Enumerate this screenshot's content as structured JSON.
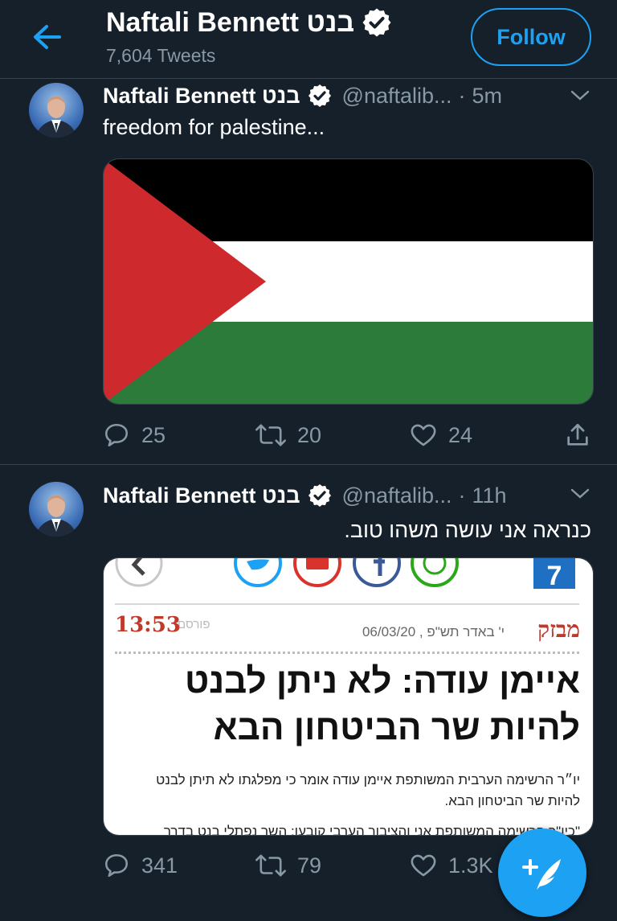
{
  "header": {
    "title": "Naftali Bennett בנט",
    "tweet_count": "7,604 Tweets",
    "follow_label": "Follow"
  },
  "tweets": [
    {
      "name": "Naftali Bennett בנט",
      "handle": "@naftalib...",
      "dot": "·",
      "time": "5m",
      "text": "freedom for palestine...",
      "replies": "25",
      "retweets": "20",
      "likes": "24"
    },
    {
      "name": "Naftali Bennett בנט",
      "handle": "@naftalib...",
      "dot": "·",
      "time": "11h",
      "text": "כנראה אני עושה משהו טוב.",
      "replies": "341",
      "retweets": "79",
      "likes": "1.3K",
      "article": {
        "badge_number": "7",
        "breaking": "מבזק",
        "date": "י' באדר תש\"פ , 06/03/20",
        "published_label": "פורסם",
        "time": "13:53",
        "headline_1": "איימן עודה: לא ניתן לבנט",
        "headline_2": "להיות שר הביטחון הבא",
        "body_1": "יו״ר הרשימה הערבית המשותפת איימן עודה אומר כי מפלגתו לא תיתן לבנט",
        "body_2": "להיות שר הביטחון הבא.",
        "body_3": "\"כיו\"ר הרשימה המשותפת אני והציבור הערבי קובעו: השר נפתלי בנט בדרך"
      }
    }
  ],
  "colors": {
    "background": "#15202b",
    "accent": "#1da1f2",
    "secondary_text": "#8899a6",
    "divider": "#38444d",
    "flag_red": "#ce2a2e",
    "flag_green": "#2c7b3a",
    "flag_black": "#000000",
    "flag_white": "#ffffff"
  },
  "icons": [
    "back-arrow-icon",
    "verified-badge-icon",
    "chevron-down-icon",
    "reply-icon",
    "retweet-icon",
    "like-icon",
    "share-icon",
    "compose-tweet-icon"
  ]
}
